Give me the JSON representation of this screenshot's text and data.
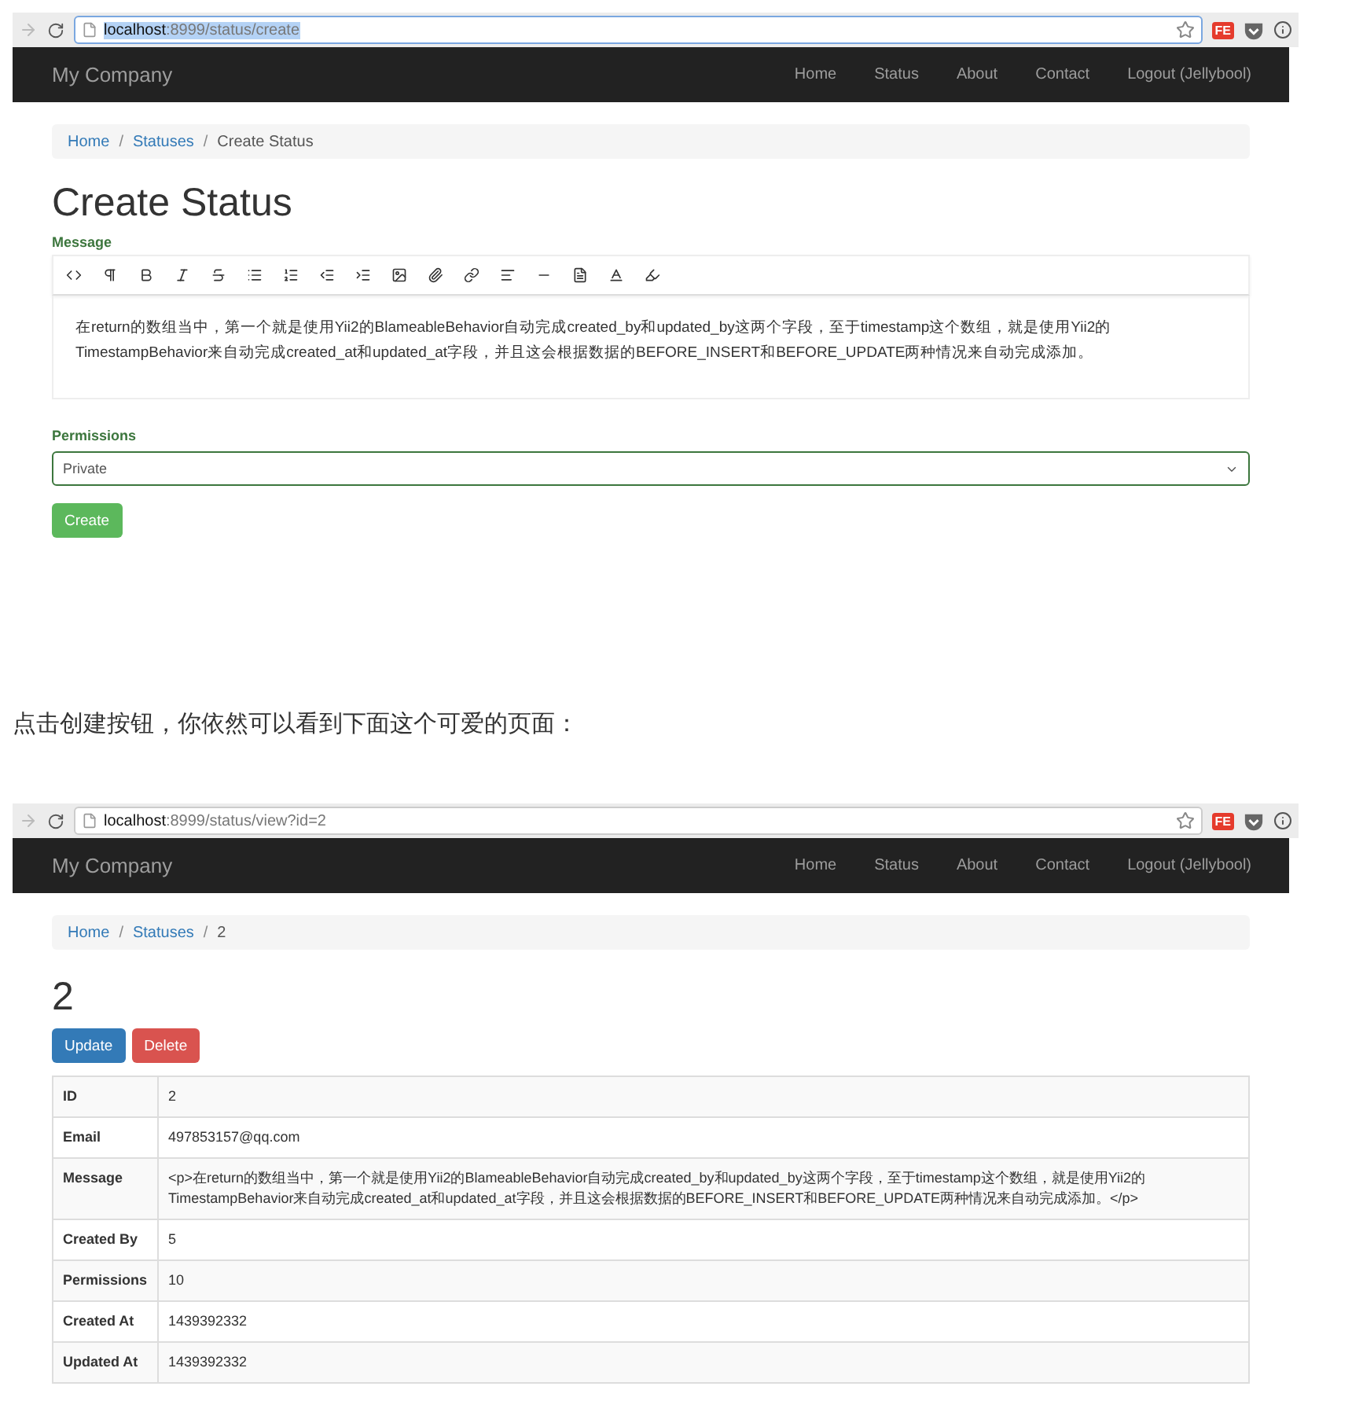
{
  "create_page": {
    "browser": {
      "url_host": "localhost",
      "url_path": ":8999/status/create",
      "url_selected": true,
      "extension": "FE"
    },
    "navbar": {
      "brand": "My Company",
      "links": [
        "Home",
        "Status",
        "About",
        "Contact",
        "Logout (Jellybool)"
      ]
    },
    "breadcrumb": [
      {
        "label": "Home",
        "link": true
      },
      {
        "label": "Statuses",
        "link": true
      },
      {
        "label": "Create Status",
        "link": false
      }
    ],
    "breadcrumb_separator": "/",
    "title": "Create Status",
    "message_label": "Message",
    "editor_text": "在return的数组当中，第一个就是使用Yii2的BlameableBehavior自动完成created_by和updated_by这两个字段，至于timestamp这个数组，就是使用Yii2的TimestampBehavior来自动完成created_at和updated_at字段，并且这会根据数据的BEFORE_INSERT和BEFORE_UPDATE两种情况来自动完成添加。",
    "permissions_label": "Permissions",
    "permissions_value": "Private",
    "submit": "Create"
  },
  "caption": "点击创建按钮，你依然可以看到下面这个可爱的页面：",
  "view_page": {
    "browser": {
      "url_host": "localhost",
      "url_path": ":8999/status/view?id=2",
      "url_selected": false,
      "extension": "FE"
    },
    "navbar": {
      "brand": "My Company",
      "links": [
        "Home",
        "Status",
        "About",
        "Contact",
        "Logout (Jellybool)"
      ]
    },
    "breadcrumb": [
      {
        "label": "Home",
        "link": true
      },
      {
        "label": "Statuses",
        "link": true
      },
      {
        "label": "2",
        "link": false
      }
    ],
    "breadcrumb_separator": "/",
    "title": "2",
    "buttons": [
      {
        "label": "Update",
        "kind": "primary"
      },
      {
        "label": "Delete",
        "kind": "danger"
      }
    ],
    "details": [
      {
        "label": "ID",
        "value": "2"
      },
      {
        "label": "Email",
        "value": "497853157@qq.com"
      },
      {
        "label": "Message",
        "value": "<p>在return的数组当中，第一个就是使用Yii2的BlameableBehavior自动完成created_by和updated_by这两个字段，至于timestamp这个数组，就是使用Yii2的TimestampBehavior来自动完成created_at和updated_at字段，并且这会根据数据的BEFORE_INSERT和BEFORE_UPDATE两种情况来自动完成添加。</p>"
      },
      {
        "label": "Created By",
        "value": "5"
      },
      {
        "label": "Permissions",
        "value": "10"
      },
      {
        "label": "Created At",
        "value": "1439392332"
      },
      {
        "label": "Updated At",
        "value": "1439392332"
      }
    ]
  }
}
